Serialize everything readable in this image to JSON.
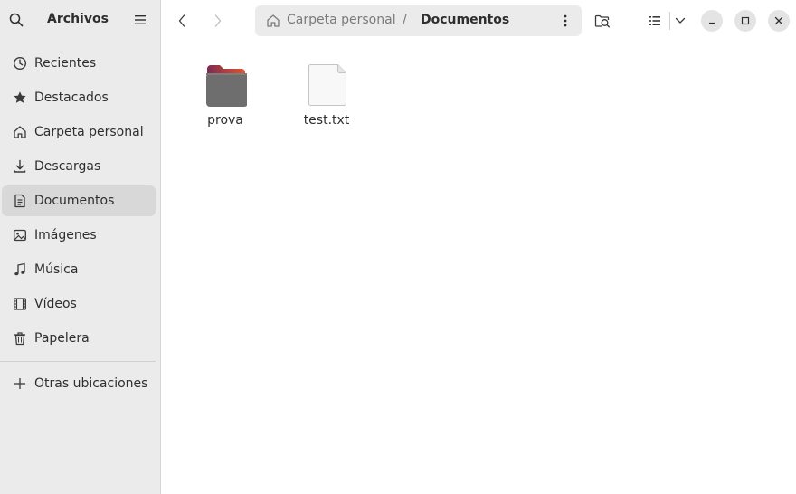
{
  "app": {
    "title": "Archivos"
  },
  "sidebar": {
    "items": [
      {
        "label": "Recientes",
        "icon": "clock-icon"
      },
      {
        "label": "Destacados",
        "icon": "star-icon"
      },
      {
        "label": "Carpeta personal",
        "icon": "home-icon"
      },
      {
        "label": "Descargas",
        "icon": "download-icon"
      },
      {
        "label": "Documentos",
        "icon": "document-icon",
        "active": true
      },
      {
        "label": "Imágenes",
        "icon": "image-icon"
      },
      {
        "label": "Música",
        "icon": "music-icon"
      },
      {
        "label": "Vídeos",
        "icon": "video-icon"
      },
      {
        "label": "Papelera",
        "icon": "trash-icon"
      }
    ],
    "other": {
      "label": "Otras ubicaciones",
      "icon": "plus-icon"
    }
  },
  "pathbar": {
    "segments": [
      "Carpeta personal",
      "Documentos"
    ],
    "separator": "/"
  },
  "files": [
    {
      "name": "prova",
      "type": "folder"
    },
    {
      "name": "test.txt",
      "type": "text-file"
    }
  ],
  "colors": {
    "sidebar_bg": "#ebebeb",
    "active_item_bg": "#d8d8d8",
    "folder_top": "#8a2a4e",
    "folder_body": "#6b6b6b",
    "folder_accent": "#e8562a"
  }
}
